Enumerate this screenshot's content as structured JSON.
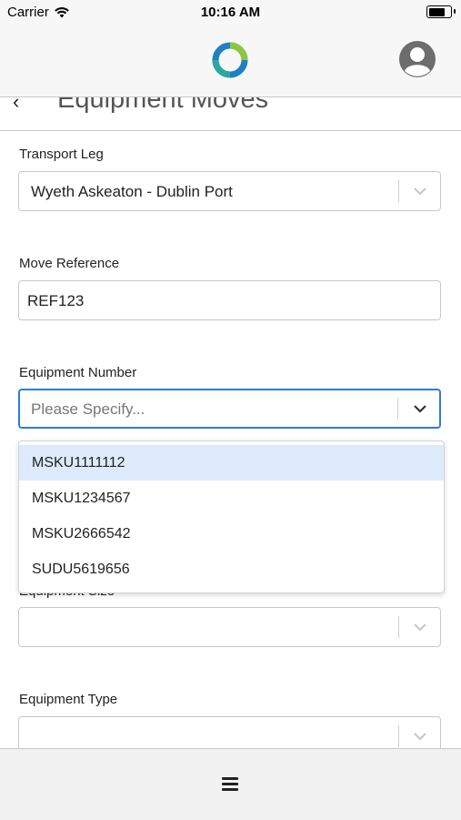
{
  "status_bar": {
    "carrier": "Carrier",
    "time": "10:16 AM",
    "battery_level": 0.85
  },
  "header": {
    "logo_icon": "app-logo-ring-icon",
    "profile_icon": "user-avatar-icon"
  },
  "page": {
    "title": "Equipment Moves",
    "back_icon": "chevron-left-icon"
  },
  "form": {
    "transport_leg": {
      "label": "Transport Leg",
      "value": "Wyeth Askeaton - Dublin Port"
    },
    "move_reference": {
      "label": "Move Reference",
      "value": "REF123"
    },
    "equipment_number": {
      "label": "Equipment Number",
      "placeholder": "Please Specify...",
      "options": [
        "MSKU1111112",
        "MSKU1234567",
        "MSKU2666542",
        "SUDU5619656"
      ],
      "highlighted_index": 0
    },
    "equipment_size": {
      "label": "Equipment Size",
      "value": ""
    },
    "equipment_type": {
      "label": "Equipment Type",
      "value": ""
    }
  },
  "bottom_bar": {
    "menu_icon": "hamburger-menu-icon"
  },
  "colors": {
    "focus_border": "#2d7be0",
    "option_highlight": "#dceafc",
    "logo_green": "#8cc63f",
    "logo_blue": "#1f7fc4"
  }
}
